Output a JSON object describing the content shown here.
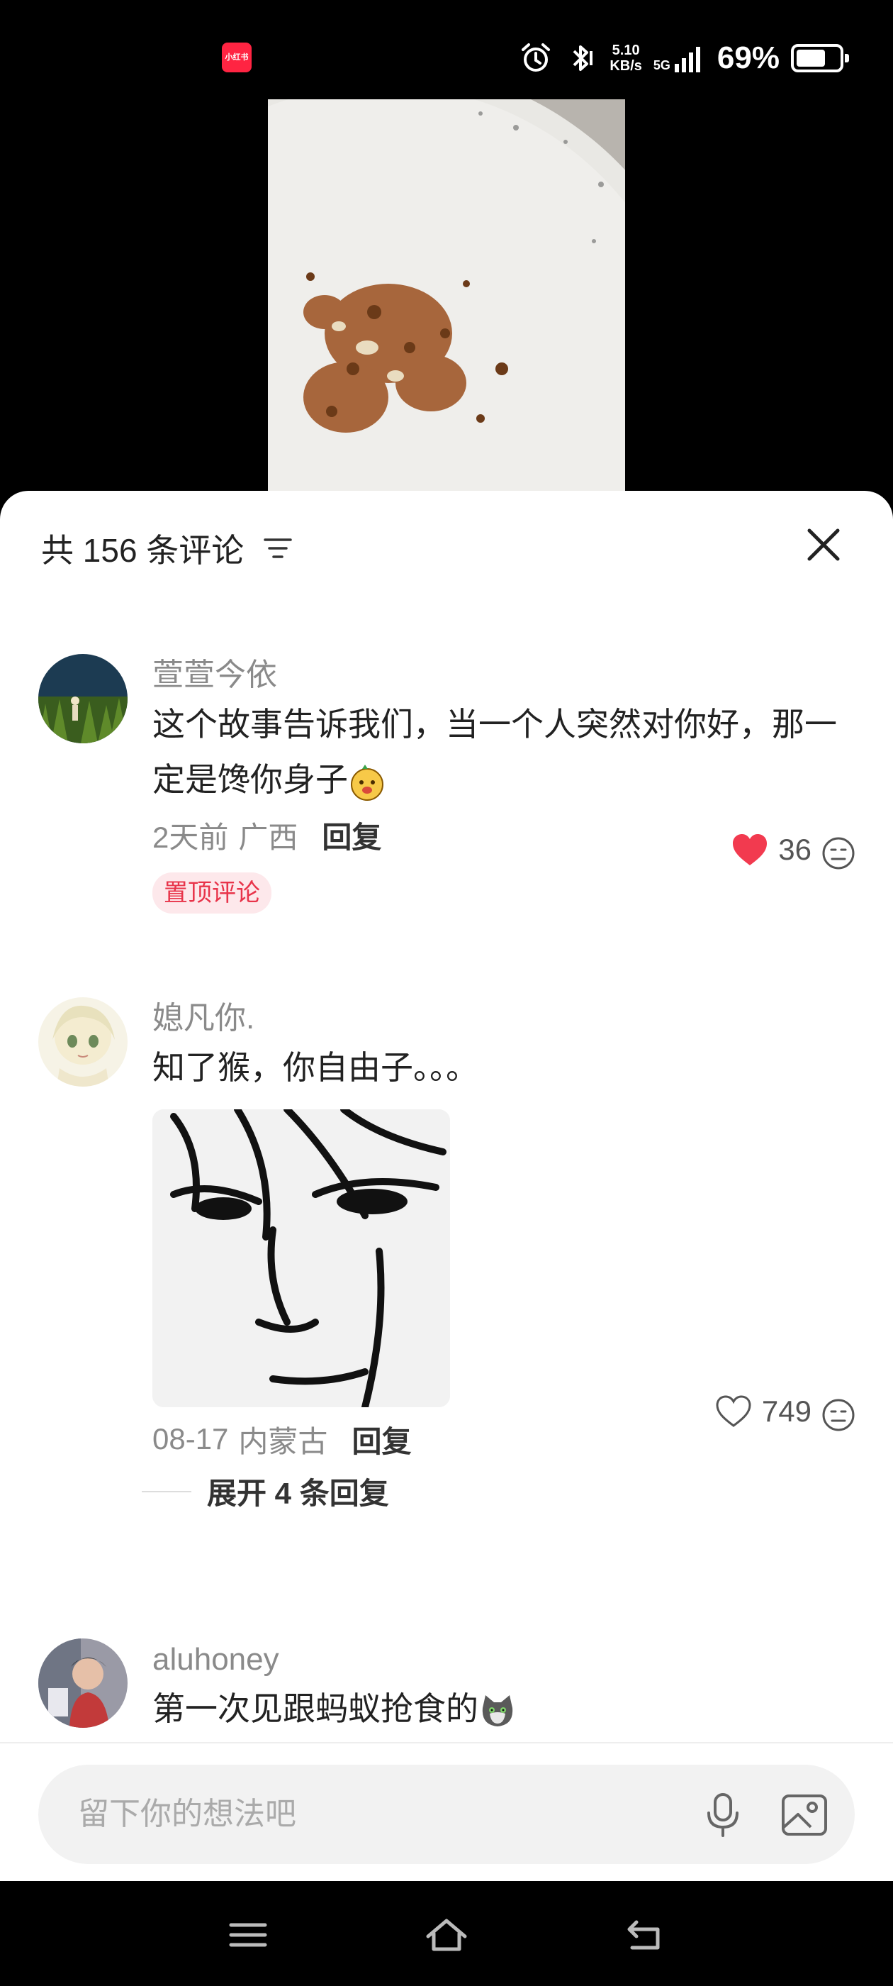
{
  "status_bar": {
    "app_badge": "小红书",
    "net_speed_value": "5.10",
    "net_speed_unit": "KB/s",
    "network_type": "5G",
    "battery_percent": "69%",
    "battery_level": 0.69,
    "icons": [
      "alarm-icon",
      "bluetooth-icon",
      "signal-icon",
      "battery-icon"
    ]
  },
  "comments_header": {
    "title": "共 156 条评论",
    "sort_icon": "sort-icon",
    "close_icon": "close-icon"
  },
  "comments": [
    {
      "username": "萱萱今依",
      "text": "这个故事告诉我们，当一个人突然对你好，那一定是馋你身子",
      "text_emoji": "smirk-emoji-icon",
      "date": "2天前",
      "region": "广西",
      "reply_label": "回复",
      "likes": "36",
      "liked": true,
      "pinned_label": "置顶评论"
    },
    {
      "username": "媳凡你.",
      "text": "知了猴，你自由子。。。",
      "has_sticker": true,
      "date": "08-17",
      "region": "内蒙古",
      "reply_label": "回复",
      "likes": "749",
      "liked": false,
      "expand_replies_label": "展开 4 条回复"
    },
    {
      "username": "aluhoney",
      "text": "第一次见跟蚂蚁抢食的",
      "text_emoji": "cat-emoji-icon"
    }
  ],
  "input_bar": {
    "placeholder": "留下你的想法吧",
    "icons": [
      "microphone-icon",
      "image-icon"
    ]
  },
  "nav_bar": {
    "icons": [
      "menu-icon",
      "home-icon",
      "back-icon"
    ]
  },
  "colors": {
    "accent_red": "#ff2442",
    "like_red": "#f23a4f",
    "pin_badge_bg": "#fde8eb"
  }
}
